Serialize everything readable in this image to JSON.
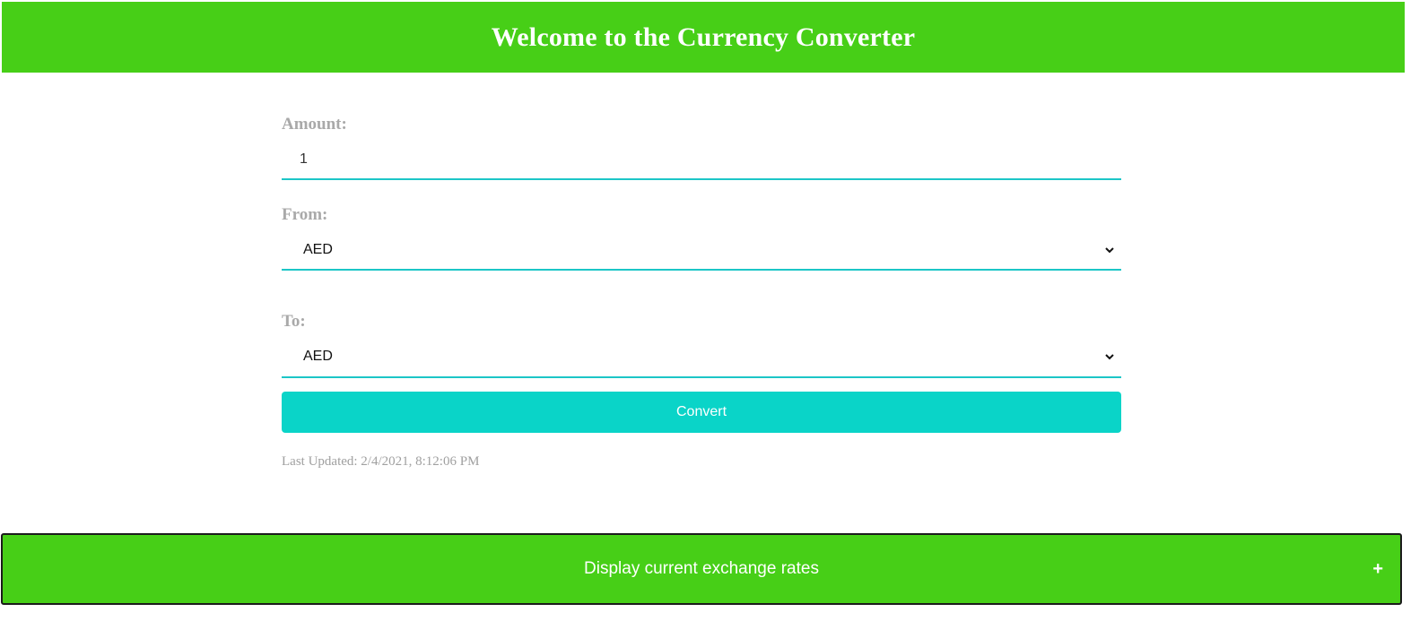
{
  "header": {
    "title": "Welcome to the Currency Converter"
  },
  "form": {
    "amount_label": "Amount:",
    "amount_value": "1",
    "from_label": "From:",
    "from_value": "AED",
    "to_label": "To:",
    "to_value": "AED",
    "convert_label": "Convert",
    "last_updated": "Last Updated: 2/4/2021, 8:12:06 PM"
  },
  "rates_panel": {
    "label": "Display current exchange rates",
    "expand_symbol": "+"
  },
  "colors": {
    "header_green": "#47cf17",
    "accent_teal": "#0ad4c8",
    "underline_teal": "#1cc6c7",
    "label_gray": "#a9a9a9"
  },
  "icons": {
    "select_arrow": "chevron-down-icon",
    "expand": "plus-icon"
  }
}
